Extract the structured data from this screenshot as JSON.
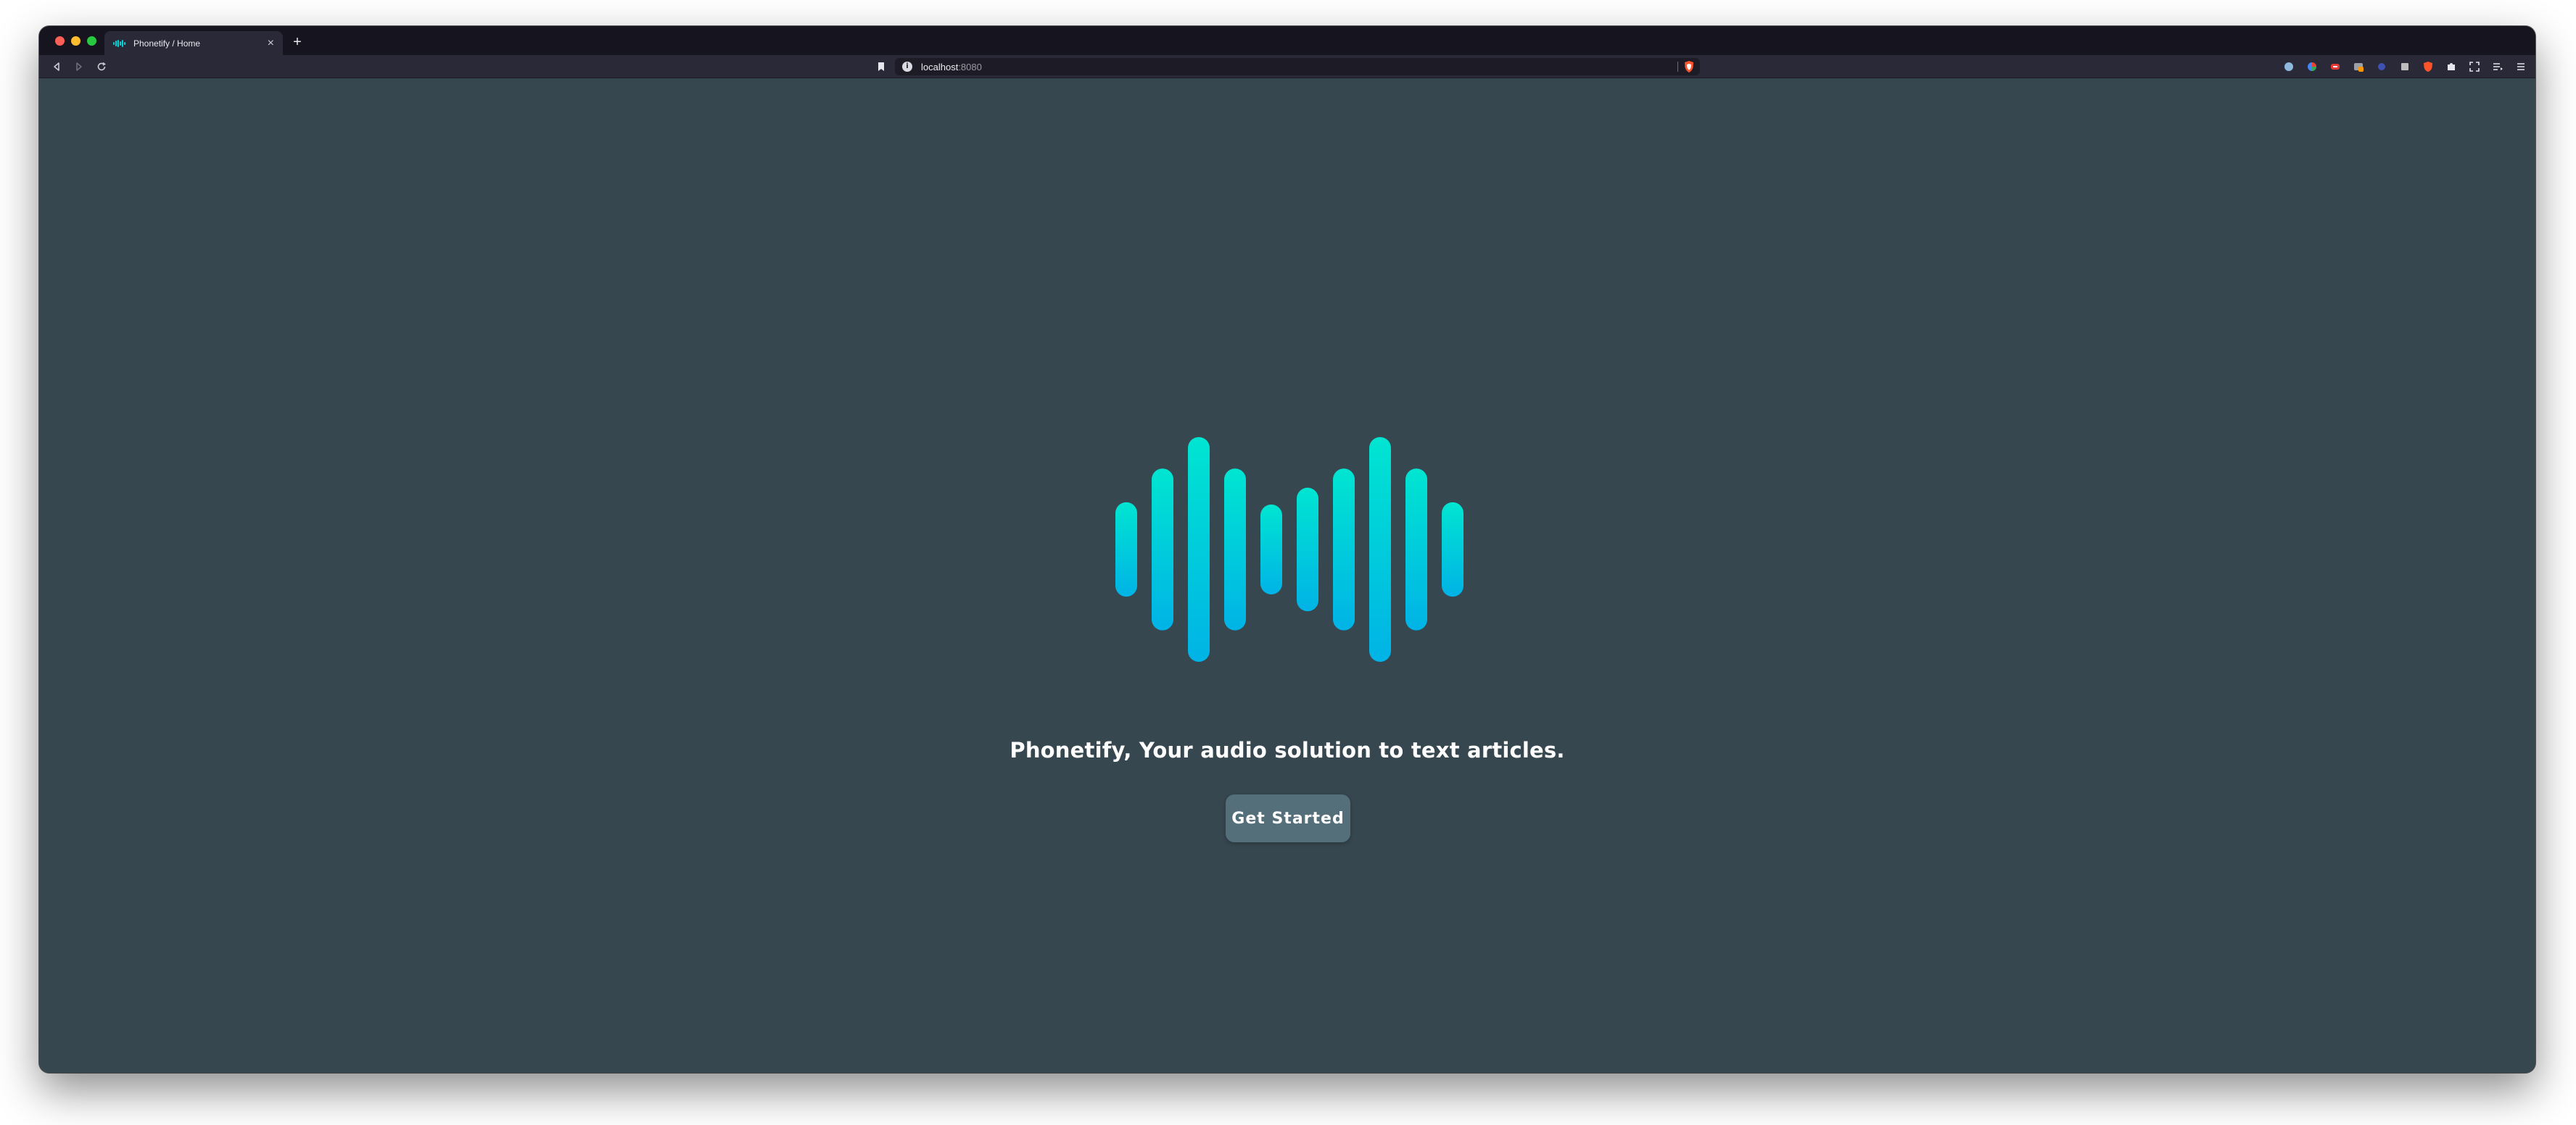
{
  "browser": {
    "tab": {
      "title": "Phonetify / Home",
      "close_glyph": "×"
    },
    "new_tab_glyph": "+",
    "url": {
      "host": "localhost",
      "port": ":8080"
    }
  },
  "page": {
    "tagline": "Phonetify, Your audio solution to text articles.",
    "cta_label": "Get Started"
  },
  "logo": {
    "bar_levels": [
      0.42,
      0.72,
      1.0,
      0.72,
      0.4,
      0.55,
      0.72,
      1.0,
      0.72,
      0.42
    ],
    "gradient_top": "#00e5d1",
    "gradient_bottom": "#00b3e6"
  },
  "colors": {
    "page_background": "#37474f",
    "button_background": "#546e7a",
    "text": "#ffffff"
  },
  "icons": {
    "toolbar": [
      "back-icon",
      "forward-icon",
      "reload-icon",
      "bookmark-icon",
      "info-icon",
      "brave-shield-icon"
    ],
    "extensions": [
      "extension-1-icon",
      "extension-2-icon",
      "extension-3-icon",
      "extension-4-icon",
      "extension-5-icon",
      "extension-6-icon",
      "extension-7-icon",
      "extension-8-icon",
      "puzzle-icon",
      "fullscreen-icon",
      "playlist-icon",
      "menu-icon"
    ]
  }
}
